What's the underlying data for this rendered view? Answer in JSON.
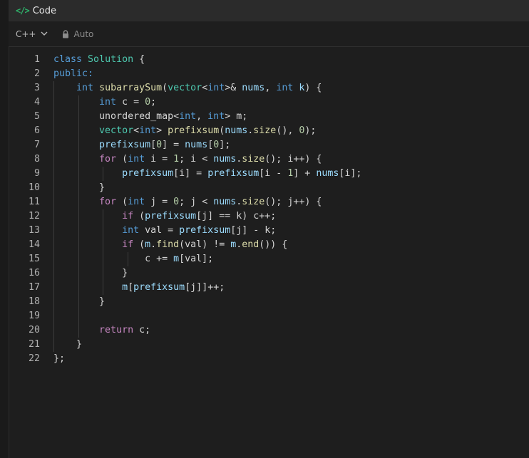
{
  "window": {
    "title": "Code",
    "title_icon": "</>"
  },
  "toolbar": {
    "language": "C++",
    "mode": "Auto"
  },
  "colors": {
    "keyword": "#569cd6",
    "type": "#4ec9b0",
    "control": "#c586c0",
    "function": "#dcdcaa",
    "number": "#b5cea8",
    "variable": "#9cdcfe",
    "plain": "#d4d4d4"
  },
  "editor": {
    "lines": [
      {
        "n": "1",
        "tokens": [
          {
            "t": "class",
            "c": "kw"
          },
          {
            "t": " "
          },
          {
            "t": "Solution",
            "c": "ty"
          },
          {
            "t": " {"
          }
        ]
      },
      {
        "n": "2",
        "tokens": [
          {
            "t": "public:",
            "c": "kw"
          }
        ]
      },
      {
        "n": "3",
        "tokens": [
          {
            "t": "    "
          },
          {
            "t": "int",
            "c": "kw"
          },
          {
            "t": " "
          },
          {
            "t": "subarraySum",
            "c": "fn"
          },
          {
            "t": "("
          },
          {
            "t": "vector",
            "c": "ty"
          },
          {
            "t": "<"
          },
          {
            "t": "int",
            "c": "kw"
          },
          {
            "t": ">& "
          },
          {
            "t": "nums",
            "c": "var"
          },
          {
            "t": ", "
          },
          {
            "t": "int",
            "c": "kw"
          },
          {
            "t": " "
          },
          {
            "t": "k",
            "c": "var"
          },
          {
            "t": ") {"
          }
        ]
      },
      {
        "n": "4",
        "tokens": [
          {
            "t": "        "
          },
          {
            "t": "int",
            "c": "kw"
          },
          {
            "t": " c = "
          },
          {
            "t": "0",
            "c": "num"
          },
          {
            "t": ";"
          }
        ]
      },
      {
        "n": "5",
        "tokens": [
          {
            "t": "        unordered_map<"
          },
          {
            "t": "int",
            "c": "kw"
          },
          {
            "t": ", "
          },
          {
            "t": "int",
            "c": "kw"
          },
          {
            "t": "> m;"
          }
        ]
      },
      {
        "n": "6",
        "tokens": [
          {
            "t": "        "
          },
          {
            "t": "vector",
            "c": "ty"
          },
          {
            "t": "<"
          },
          {
            "t": "int",
            "c": "kw"
          },
          {
            "t": "> "
          },
          {
            "t": "prefixsum",
            "c": "fn"
          },
          {
            "t": "("
          },
          {
            "t": "nums",
            "c": "var"
          },
          {
            "t": "."
          },
          {
            "t": "size",
            "c": "fn"
          },
          {
            "t": "(), "
          },
          {
            "t": "0",
            "c": "num"
          },
          {
            "t": ");"
          }
        ]
      },
      {
        "n": "7",
        "tokens": [
          {
            "t": "        "
          },
          {
            "t": "prefixsum",
            "c": "var"
          },
          {
            "t": "["
          },
          {
            "t": "0",
            "c": "num"
          },
          {
            "t": "] = "
          },
          {
            "t": "nums",
            "c": "var"
          },
          {
            "t": "["
          },
          {
            "t": "0",
            "c": "num"
          },
          {
            "t": "];"
          }
        ]
      },
      {
        "n": "8",
        "tokens": [
          {
            "t": "        "
          },
          {
            "t": "for",
            "c": "ctl"
          },
          {
            "t": " ("
          },
          {
            "t": "int",
            "c": "kw"
          },
          {
            "t": " i = "
          },
          {
            "t": "1",
            "c": "num"
          },
          {
            "t": "; i < "
          },
          {
            "t": "nums",
            "c": "var"
          },
          {
            "t": "."
          },
          {
            "t": "size",
            "c": "fn"
          },
          {
            "t": "(); i++) {"
          }
        ]
      },
      {
        "n": "9",
        "tokens": [
          {
            "t": "            "
          },
          {
            "t": "prefixsum",
            "c": "var"
          },
          {
            "t": "[i] = "
          },
          {
            "t": "prefixsum",
            "c": "var"
          },
          {
            "t": "[i - "
          },
          {
            "t": "1",
            "c": "num"
          },
          {
            "t": "] + "
          },
          {
            "t": "nums",
            "c": "var"
          },
          {
            "t": "[i];"
          }
        ]
      },
      {
        "n": "10",
        "tokens": [
          {
            "t": "        }"
          }
        ]
      },
      {
        "n": "11",
        "tokens": [
          {
            "t": "        "
          },
          {
            "t": "for",
            "c": "ctl"
          },
          {
            "t": " ("
          },
          {
            "t": "int",
            "c": "kw"
          },
          {
            "t": " j = "
          },
          {
            "t": "0",
            "c": "num"
          },
          {
            "t": "; j < "
          },
          {
            "t": "nums",
            "c": "var"
          },
          {
            "t": "."
          },
          {
            "t": "size",
            "c": "fn"
          },
          {
            "t": "(); j++) {"
          }
        ]
      },
      {
        "n": "12",
        "tokens": [
          {
            "t": "            "
          },
          {
            "t": "if",
            "c": "ctl"
          },
          {
            "t": " ("
          },
          {
            "t": "prefixsum",
            "c": "var"
          },
          {
            "t": "[j] == k) c++;"
          }
        ]
      },
      {
        "n": "13",
        "tokens": [
          {
            "t": "            "
          },
          {
            "t": "int",
            "c": "kw"
          },
          {
            "t": " val = "
          },
          {
            "t": "prefixsum",
            "c": "var"
          },
          {
            "t": "[j] - k;"
          }
        ]
      },
      {
        "n": "14",
        "tokens": [
          {
            "t": "            "
          },
          {
            "t": "if",
            "c": "ctl"
          },
          {
            "t": " ("
          },
          {
            "t": "m",
            "c": "var"
          },
          {
            "t": "."
          },
          {
            "t": "find",
            "c": "fn"
          },
          {
            "t": "(val) != "
          },
          {
            "t": "m",
            "c": "var"
          },
          {
            "t": "."
          },
          {
            "t": "end",
            "c": "fn"
          },
          {
            "t": "()) {"
          }
        ]
      },
      {
        "n": "15",
        "tokens": [
          {
            "t": "                c += "
          },
          {
            "t": "m",
            "c": "var"
          },
          {
            "t": "[val];"
          }
        ]
      },
      {
        "n": "16",
        "tokens": [
          {
            "t": "            }"
          }
        ]
      },
      {
        "n": "17",
        "tokens": [
          {
            "t": "            "
          },
          {
            "t": "m",
            "c": "var"
          },
          {
            "t": "["
          },
          {
            "t": "prefixsum",
            "c": "var"
          },
          {
            "t": "[j]]++;"
          }
        ]
      },
      {
        "n": "18",
        "tokens": [
          {
            "t": "        }"
          }
        ]
      },
      {
        "n": "19",
        "tokens": [
          {
            "t": ""
          }
        ]
      },
      {
        "n": "20",
        "tokens": [
          {
            "t": "        "
          },
          {
            "t": "return",
            "c": "ctl"
          },
          {
            "t": " c;"
          }
        ]
      },
      {
        "n": "21",
        "tokens": [
          {
            "t": "    }"
          }
        ]
      },
      {
        "n": "22",
        "tokens": [
          {
            "t": "};"
          }
        ]
      }
    ]
  }
}
